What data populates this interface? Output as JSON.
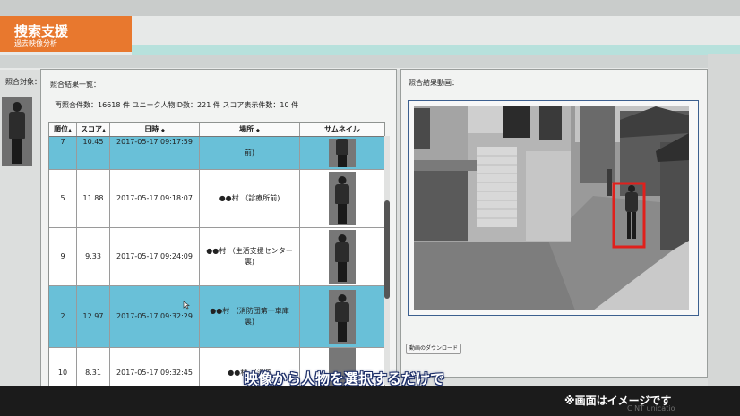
{
  "top_nav_faint": [
    "",
    "",
    "",
    ""
  ],
  "header": {
    "title": "捜索支援",
    "subtitle": "過去映像分析"
  },
  "nav_faint": [
    "",
    ""
  ],
  "target": {
    "label": "照合対象："
  },
  "results": {
    "title": "照合結果一覧：",
    "stats": "再照合件数：16618 件 ユニーク人物ID数：221 件 スコア表示件数：10 件",
    "columns": [
      "順位",
      "スコア",
      "日時",
      "場所",
      "サムネイル"
    ],
    "sort_icons": [
      "▲",
      "▲",
      "◆",
      "◆"
    ],
    "rows": [
      {
        "rank": "7",
        "score": "10.45",
        "datetime": "2017-05-17 09:17:59",
        "place": "前)",
        "selected": true
      },
      {
        "rank": "5",
        "score": "11.88",
        "datetime": "2017-05-17 09:18:07",
        "place": "●●村 （診療所前)",
        "selected": false
      },
      {
        "rank": "9",
        "score": "9.33",
        "datetime": "2017-05-17 09:24:09",
        "place": "●●村 （生活支援センター裏)",
        "selected": false
      },
      {
        "rank": "2",
        "score": "12.97",
        "datetime": "2017-05-17 09:32:29",
        "place": "●●村 （消防団第一車庫裏)",
        "selected": true
      },
      {
        "rank": "10",
        "score": "8.31",
        "datetime": "2017-05-17 09:32:45",
        "place": "●●村 （消防",
        "selected": false
      }
    ]
  },
  "video": {
    "title": "照合結果動画：",
    "download_label": "動画のダウンロード"
  },
  "overlay": {
    "subtitle": "映像から人物を選択するだけで",
    "note": "※画面はイメージです",
    "brand": "C          NT    unicatio"
  },
  "colors": {
    "accent": "#e8782e",
    "selected_row": "#69c0d8",
    "detection_box": "#e0201c"
  }
}
